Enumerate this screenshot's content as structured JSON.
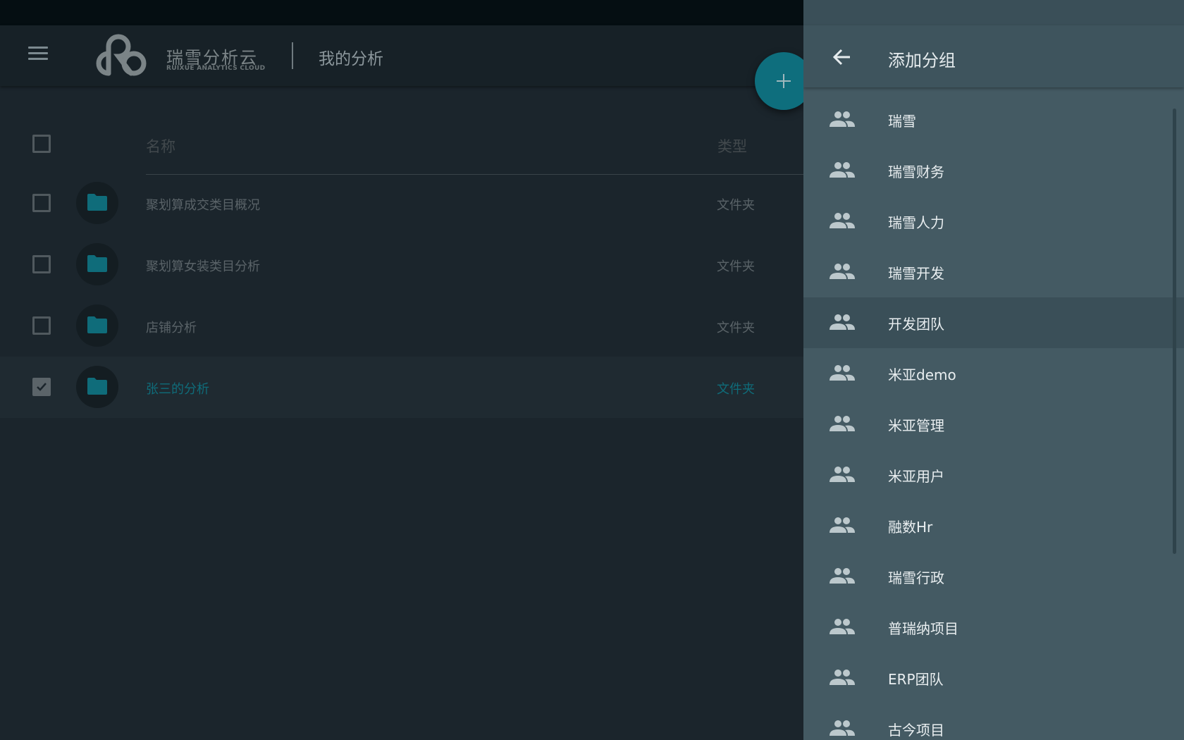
{
  "appbar": {
    "logo_text": "瑞雪分析云",
    "logo_sub": "RUIXUE ANALYTICS CLOUD",
    "page_title": "我的分析"
  },
  "table": {
    "header_name": "名称",
    "header_type": "类型",
    "rows": [
      {
        "name": "聚划算成交类目概况",
        "type": "文件夹",
        "checked": false
      },
      {
        "name": "聚划算女装类目分析",
        "type": "文件夹",
        "checked": false
      },
      {
        "name": "店铺分析",
        "type": "文件夹",
        "checked": false
      },
      {
        "name": "张三的分析",
        "type": "文件夹",
        "checked": true
      }
    ]
  },
  "drawer": {
    "title": "添加分组",
    "groups": [
      {
        "label": "瑞雪",
        "icon": "group-icon"
      },
      {
        "label": "瑞雪财务",
        "icon": "group-icon"
      },
      {
        "label": "瑞雪人力",
        "icon": "group-icon"
      },
      {
        "label": "瑞雪开发",
        "icon": "group-icon"
      },
      {
        "label": "开发团队",
        "icon": "group-icon"
      },
      {
        "label": "米亚demo",
        "icon": "group-icon"
      },
      {
        "label": "米亚管理",
        "icon": "group-icon"
      },
      {
        "label": "米亚用户",
        "icon": "group-icon"
      },
      {
        "label": "融数Hr",
        "icon": "group-icon"
      },
      {
        "label": "瑞雪行政",
        "icon": "group-icon"
      },
      {
        "label": "普瑞纳项目",
        "icon": "group-icon"
      },
      {
        "label": "ERP团队",
        "icon": "group-icon"
      },
      {
        "label": "古今项目",
        "icon": "group-icon"
      }
    ]
  },
  "colors": {
    "accent": "#0e6e7d",
    "drawer_bg": "#445a63",
    "page_bg": "#1b252c"
  }
}
